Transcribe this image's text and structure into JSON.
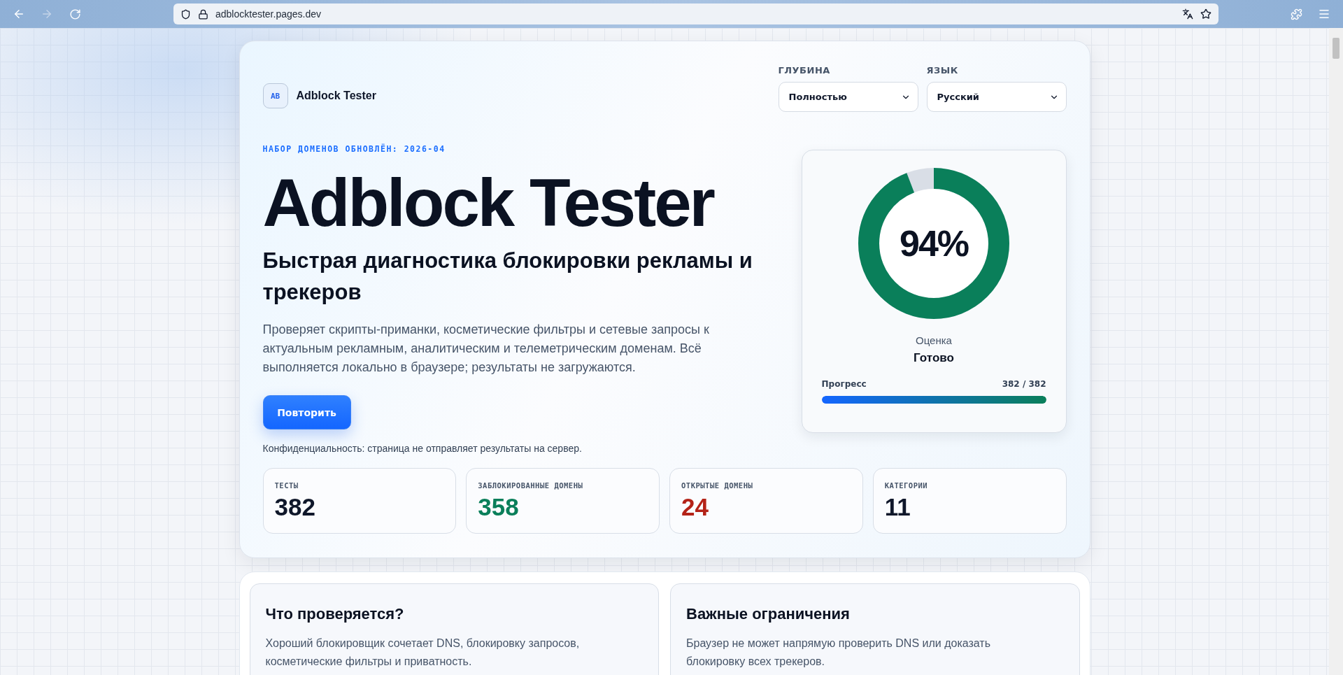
{
  "browser": {
    "url": "adblocktester.pages.dev"
  },
  "brand": {
    "logo": "AB",
    "name": "Adblock Tester"
  },
  "controls": [
    {
      "label": "ГЛУБИНА",
      "value": "Полностью"
    },
    {
      "label": "ЯЗЫК",
      "value": "Русский"
    }
  ],
  "hero": {
    "eyebrow": "НАБОР ДОМЕНОВ ОБНОВЛЁН: 2026-04",
    "title": "Adblock Tester",
    "subtitle": "Быстрая диагностика блокировки рекламы и трекеров",
    "description": "Проверяет скрипты-приманки, косметические фильтры и сетевые запросы к актуальным рекламным, аналитическим и телеметрическим доменам. Всё выполняется локально в браузере; результаты не загружаются.",
    "button": "Повторить",
    "privacy": "Конфиденциальность: страница не отправляет результаты на сервер."
  },
  "score": {
    "value": "94%",
    "level": 0.94,
    "label": "Оценка",
    "status": "Готово",
    "progress_label": "Прогресс",
    "progress_text": "382 / 382",
    "progress": {
      "level": 1
    }
  },
  "stats": [
    {
      "label": "ТЕСТЫ",
      "value": "382",
      "color": "#0f172a"
    },
    {
      "label": "ЗАБЛОКИРОВАННЫЕ ДОМЕНЫ",
      "value": "358",
      "color": "#0a7f5a"
    },
    {
      "label": "ОТКРЫТЫЕ ДОМЕНЫ",
      "value": "24",
      "color": "#b42318"
    },
    {
      "label": "КАТЕГОРИИ",
      "value": "11",
      "color": "#0f172a"
    }
  ],
  "info_cards": [
    {
      "title": "Что проверяется?",
      "text": "Хороший блокировщик сочетает DNS, блокировку запросов, косметические фильтры и приватность."
    },
    {
      "title": "Важные ограничения",
      "text": "Браузер не может напрямую проверить DNS или доказать блокировку всех трекеров."
    }
  ]
}
